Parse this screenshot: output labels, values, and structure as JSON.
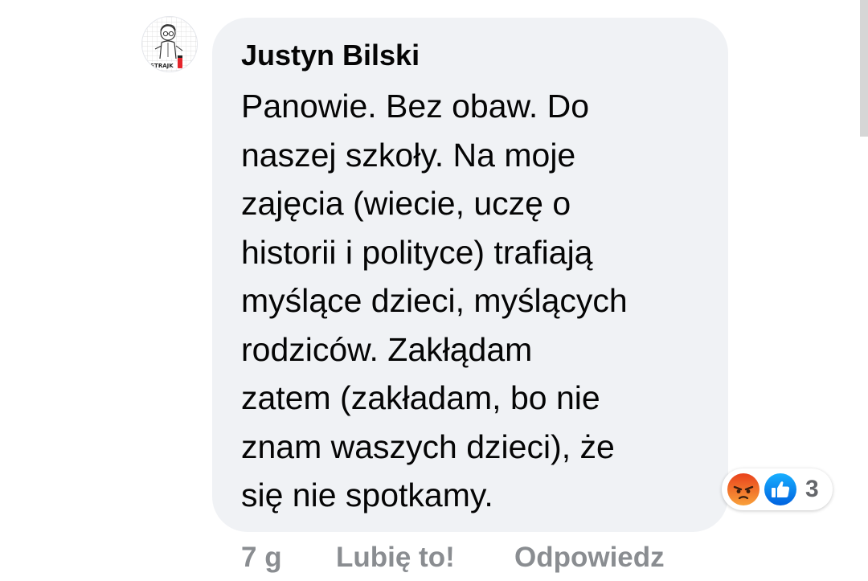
{
  "comment": {
    "author": "Justyn Bilski",
    "text_lines": [
      "Panowie. Bez obaw. Do",
      "naszej szkoły. Na moje",
      "zajęcia (wiecie, uczę o",
      "historii i polityce) trafiają",
      "myślące dzieci, myślących",
      "rodziców. Zakłądam",
      "zatem (zakładam, bo nie",
      "znam waszych dzieci), że",
      "się nie spotkamy."
    ],
    "avatar_badge": "STRAJK",
    "reactions": {
      "icons": [
        "angry-icon",
        "like-icon"
      ],
      "count": "3"
    },
    "actions": {
      "time": "7 g",
      "like": "Lubię to!",
      "reply": "Odpowiedz"
    }
  },
  "colors": {
    "bubble_bg": "#f0f2f5",
    "text": "#050505",
    "secondary_text": "#8a8d91",
    "like_blue": "#1877f2",
    "angry_orange": "#f7714c",
    "strike_red": "#e4252b"
  }
}
